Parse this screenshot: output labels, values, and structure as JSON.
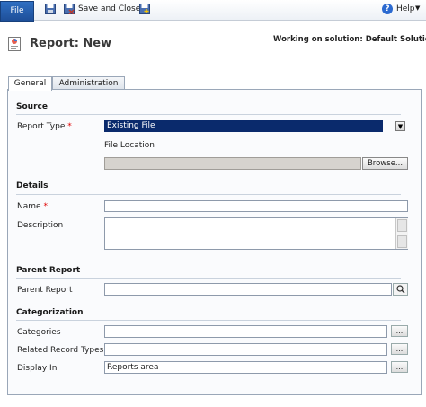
{
  "toolbar": {
    "file_label": "File",
    "save_close_label": "Save and Close",
    "help_label": "Help",
    "help_glyph": "?",
    "chevron": "▼"
  },
  "header": {
    "title": "Report: New",
    "solution_text": "Working on solution: Default Solution"
  },
  "tabs": [
    {
      "label": "General",
      "active": true
    },
    {
      "label": "Administration",
      "active": false
    }
  ],
  "sections": {
    "source": {
      "title": "Source",
      "report_type_label": "Report Type",
      "report_type_value": "Existing File",
      "file_location_label": "File Location",
      "file_location_value": "",
      "browse_label": "Browse..."
    },
    "details": {
      "title": "Details",
      "name_label": "Name",
      "name_value": "",
      "description_label": "Description",
      "description_value": ""
    },
    "parent": {
      "title": "Parent Report",
      "parent_report_label": "Parent Report",
      "parent_report_value": ""
    },
    "categorization": {
      "title": "Categorization",
      "categories_label": "Categories",
      "categories_value": "",
      "related_label": "Related Record Types",
      "related_value": "",
      "display_in_label": "Display In",
      "display_in_value": "Reports area",
      "ellipsis": "..."
    }
  },
  "required_marker": "*",
  "icons": {
    "save": "save-icon",
    "save_close": "save-close-icon",
    "save_new": "save-new-icon",
    "help": "help-icon",
    "report": "report-icon",
    "lookup": "magnifier-icon"
  },
  "colors": {
    "file_button": "#2f6fc2",
    "selected_dropdown": "#0a2a6c",
    "required": "#e00000",
    "panel_border": "#9aa7b8"
  }
}
